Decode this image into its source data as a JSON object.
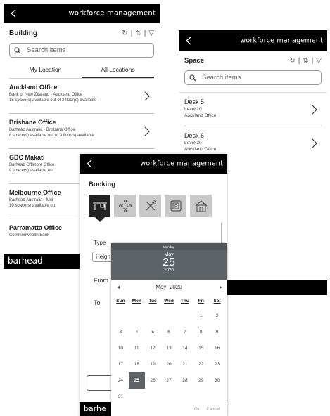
{
  "brand_name": "workforce management",
  "footer_brand": "barhead",
  "building_screen": {
    "title": "Building",
    "tools": {
      "refresh": "↻",
      "sort": "⇅",
      "filter": "▽",
      "sep": "|"
    },
    "search_placeholder": "Search items",
    "tabs": [
      "My Location",
      "All Locations"
    ],
    "items": [
      {
        "title": "Auckland Office",
        "sub1": "Bank of New Zealand - Auckland Office",
        "sub2": "15 space(s) available out of 3 floor(s) available"
      },
      {
        "title": "Brisbane Office",
        "sub1": "Barhead Australia - Brisbane Office",
        "sub2": "8 space(s) available out of 3 floor(s) available"
      },
      {
        "title": "GDC Makati",
        "sub1": "Barhead Offshore Office",
        "sub2": "9 space(s) available out"
      },
      {
        "title": "Melbourne Office",
        "sub1": "Barhead Australia - Mel",
        "sub2": "10 space(s) available ou"
      },
      {
        "title": "Parramatta Office",
        "sub1": "Commonwealth Bank -",
        "sub2": ""
      }
    ]
  },
  "space_screen": {
    "title": "Space",
    "search_placeholder": "Search items",
    "items": [
      {
        "title": "Desk 5",
        "sub1": "Level 20",
        "sub2": "Auckland Office"
      },
      {
        "title": "Desk 6",
        "sub1": "Level 20",
        "sub2": "Auckland Office"
      }
    ]
  },
  "booking_screen": {
    "title": "Booking",
    "type_label": "Type",
    "type_value": "Heigh",
    "from_label": "From",
    "to_label": "To",
    "footer_brand": "barhe"
  },
  "calendar": {
    "weekday": "Monday",
    "month": "May",
    "day": "25",
    "year": "2020",
    "nav_title": "May  2020",
    "prev": "◂",
    "next": "▸",
    "dows": [
      "Sun",
      "Mon",
      "Tue",
      "Wed",
      "Thu",
      "Fri",
      "Sat"
    ],
    "days": [
      "",
      "",
      "",
      "",
      "",
      "1",
      "2",
      "3",
      "4",
      "5",
      "6",
      "7",
      "8",
      "9",
      "10",
      "11",
      "12",
      "13",
      "14",
      "15",
      "16",
      "17",
      "18",
      "19",
      "20",
      "21",
      "22",
      "23",
      "24",
      "25",
      "26",
      "27",
      "28",
      "29",
      "30",
      "31",
      "",
      "",
      "",
      "",
      "",
      ""
    ],
    "selected": "25",
    "ok": "Ok",
    "cancel": "Cancel"
  },
  "colors": {
    "topbar": "#000000",
    "calendar_header": "#5d6366",
    "tile": "#c9c9c9"
  }
}
